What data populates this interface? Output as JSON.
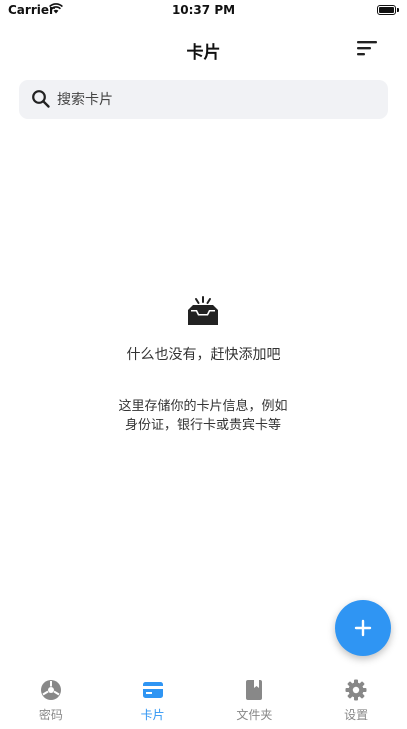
{
  "status_bar": {
    "carrier": "Carrier",
    "time": "10:37 PM"
  },
  "nav": {
    "title": "卡片",
    "sort_icon": "sort-icon"
  },
  "search": {
    "placeholder": "搜索卡片",
    "value": "",
    "icon": "search-icon"
  },
  "empty_state": {
    "icon": "inbox-icon",
    "title": "什么也没有，赶快添加吧",
    "description_line1": "这里存储你的卡片信息，例如",
    "description_line2": "身份证，银行卡或贵宾卡等"
  },
  "fab": {
    "icon": "plus-icon"
  },
  "tabs": [
    {
      "label": "密码",
      "icon": "password-icon",
      "active": false
    },
    {
      "label": "卡片",
      "icon": "card-icon",
      "active": true
    },
    {
      "label": "文件夹",
      "icon": "folder-icon",
      "active": false
    },
    {
      "label": "设置",
      "icon": "gear-icon",
      "active": false
    }
  ],
  "colors": {
    "accent": "#2f95f3",
    "inactive": "#888888",
    "search_bg": "#f1f2f5"
  }
}
